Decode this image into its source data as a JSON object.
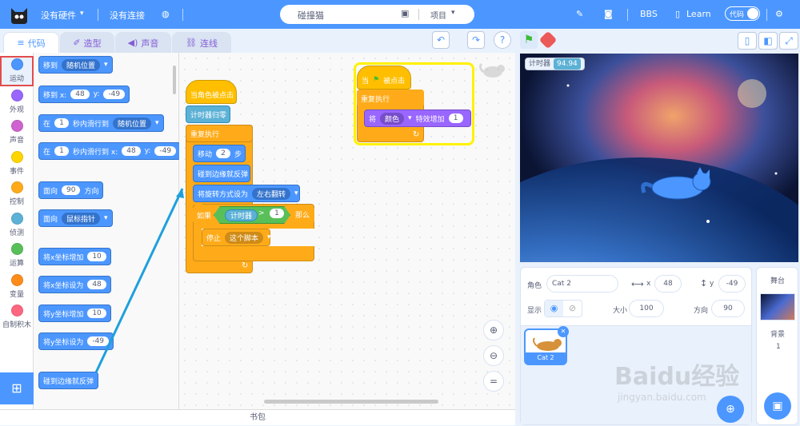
{
  "topbar": {
    "hardware": "没有硬件",
    "connection": "没有连接",
    "project_title": "碰撞猫",
    "project_menu": "项目",
    "bbs": "BBS",
    "learn": "Learn",
    "code_toggle": "代码"
  },
  "tabs": [
    "代码",
    "造型",
    "声音",
    "连线"
  ],
  "categories": [
    {
      "label": "运动",
      "color": "#4c97ff"
    },
    {
      "label": "外观",
      "color": "#9966ff"
    },
    {
      "label": "声音",
      "color": "#cf63cf"
    },
    {
      "label": "事件",
      "color": "#ffd500"
    },
    {
      "label": "控制",
      "color": "#ffab19"
    },
    {
      "label": "侦测",
      "color": "#5cb1d6"
    },
    {
      "label": "运算",
      "color": "#59c059"
    },
    {
      "label": "变量",
      "color": "#ff8c1a"
    },
    {
      "label": "自制积木",
      "color": "#ff6680"
    }
  ],
  "palette": {
    "move_to": "移到",
    "random_pos": "随机位置",
    "move_to_xy": "移到 x:",
    "x_val": "48",
    "y_label": "y:",
    "y_val": "-49",
    "in": "在",
    "one": "1",
    "glide_to": "秒内滑行到",
    "glide_to_xy": "秒内滑行到 x:",
    "face": "面向",
    "ninety": "90",
    "direction": "方向",
    "mouse_pointer": "鼠标指针",
    "change_x": "将x坐标增加",
    "ten": "10",
    "set_x": "将x坐标设为",
    "change_y": "将y坐标增加",
    "set_y": "将y坐标设为",
    "bounce": "碰到边缘就反弹"
  },
  "script1": {
    "hat": "当角色被点击",
    "reset_timer": "计时器归零",
    "forever": "重复执行",
    "move": "移动",
    "steps_val": "2",
    "steps": "步",
    "bounce": "碰到边缘就反弹",
    "rot_style": "将旋转方式设为",
    "rot_val": "左右翻转",
    "if": "如果",
    "timer": "计时器",
    "gt": ">",
    "one": "1",
    "then": "那么",
    "stop": "停止",
    "this_script": "这个脚本"
  },
  "script2": {
    "hat_when": "当",
    "hat_clicked": "被点击",
    "forever": "重复执行",
    "change_effect": "将",
    "effect": "颜色",
    "by": "特效增加",
    "val": "1"
  },
  "book_bar": "书包",
  "stage": {
    "timer_label": "计时器",
    "timer_value": "94.94"
  },
  "sprite_info": {
    "sprite_label": "角色",
    "sprite_name": "Cat 2",
    "x_label": "x",
    "x_val": "48",
    "y_label": "y",
    "y_val": "-49",
    "show_label": "显示",
    "size_label": "大小",
    "size_val": "100",
    "dir_label": "方向",
    "dir_val": "90",
    "thumb_name": "Cat 2"
  },
  "stage_panel": {
    "title": "舞台",
    "bg_label": "背景",
    "bg_count": "1"
  },
  "watermark": {
    "brand": "Baidu经验",
    "url": "jingyan.baidu.com"
  }
}
